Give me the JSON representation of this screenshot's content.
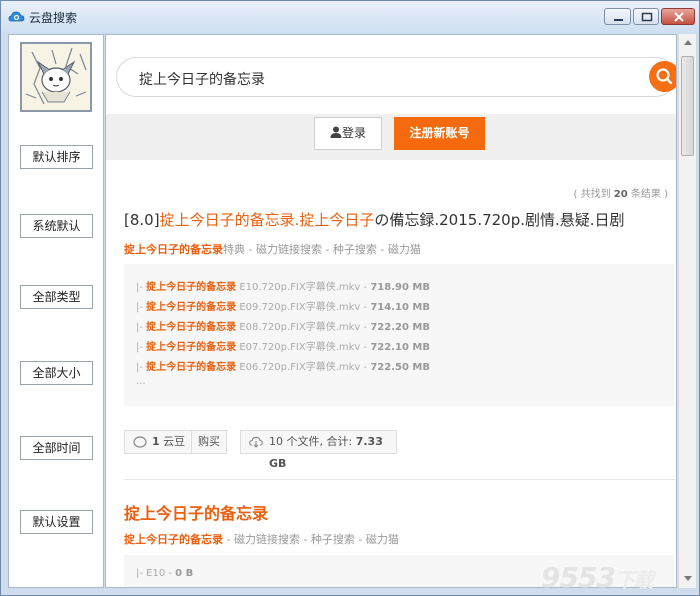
{
  "window": {
    "title": "云盘搜索",
    "icons": {
      "app": "cloud-search-icon",
      "minimize": "minimize-icon",
      "maximize": "maximize-icon",
      "close": "close-icon"
    }
  },
  "sidebar": {
    "avatar_icon": "cartoon-character-avatar",
    "buttons": [
      "默认排序",
      "系统默认",
      "全部类型",
      "全部大小",
      "全部时间",
      "默认设置"
    ]
  },
  "search": {
    "query": "掟上今日子的备忘录",
    "icon": "search-icon",
    "accent_color": "#f57014"
  },
  "auth": {
    "login_label": "登录",
    "login_icon": "user-icon",
    "register_label": "注册新账号",
    "register_color": "#f46a0d"
  },
  "results_summary": {
    "prefix": "( 共找到",
    "count": "20",
    "suffix": "条结果 )"
  },
  "results": [
    {
      "title_prefix": "[8.0]",
      "title_highlight_1": "掟上今日子的备忘录",
      "title_dot": ".",
      "title_highlight_2": "掟上今日子",
      "title_rest": "の備忘録.2015.720p.剧情.悬疑.日剧",
      "meta_highlight": "掟上今日子的备忘录",
      "meta_rest": "特典 - 磁力链接搜索 - 种子搜索 - 磁力猫",
      "files": [
        {
          "name": "掟上今日子的备忘录",
          "ext": " E10.720p.FIX字幕侠.mkv",
          "size": "718.90 MB"
        },
        {
          "name": "掟上今日子的备忘录",
          "ext": " E09.720p.FIX字幕侠.mkv",
          "size": "714.10 MB"
        },
        {
          "name": "掟上今日子的备忘录",
          "ext": " E08.720p.FIX字幕侠.mkv",
          "size": "722.20 MB"
        },
        {
          "name": "掟上今日子的备忘录",
          "ext": " E07.720p.FIX字幕侠.mkv",
          "size": "722.10 MB"
        },
        {
          "name": "掟上今日子的备忘录",
          "ext": " E06.720p.FIX字幕侠.mkv",
          "size": "722.50 MB"
        }
      ],
      "more": "...",
      "price": "1 云豆",
      "buy_label": "购买",
      "file_summary": "10 个文件, 合计:",
      "total_size": "7.33 GB",
      "icons": {
        "coin": "coin-icon",
        "cloud": "cloud-download-icon"
      }
    },
    {
      "title": "掟上今日子的备忘录",
      "meta_highlight": "掟上今日子的备忘录",
      "meta_rest": " - 磁力链接搜索 - 种子搜索 - 磁力猫",
      "files": [
        {
          "prefix": "|- E10 - ",
          "size": "0 B"
        }
      ]
    }
  ],
  "watermark": {
    "text": "9553",
    "suffix": "下载"
  }
}
